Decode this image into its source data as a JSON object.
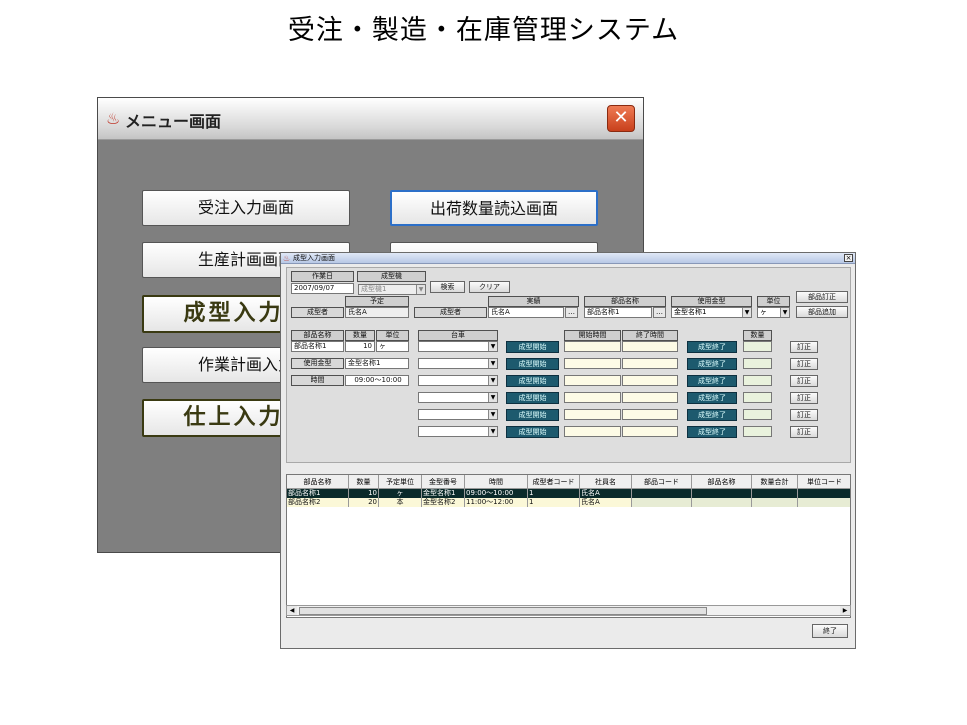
{
  "slide": {
    "title": "受注・製造・在庫管理システム"
  },
  "menu": {
    "title": "メニュー画面",
    "close_glyph": "✕",
    "buttons": [
      "受注入力画面",
      "出荷数量読込画面",
      "生産計画画面",
      "",
      "成型入力画",
      "作業計画入力",
      "仕上入力画"
    ]
  },
  "molding": {
    "title": "成型入力画面",
    "work_date_label": "作業日",
    "work_date_value": "2007/09/07",
    "machine_label": "成型機",
    "machine_value": "成型機1",
    "search_label": "検索",
    "clear_label": "クリア",
    "plan_label": "予定",
    "molder_label": "成型者",
    "plan_molder_value": "氏名A",
    "actual_label": "実績",
    "actual_molder_label": "成型者",
    "actual_molder_value": "氏名A",
    "part_name_label": "部品名称",
    "part_name_value": "部品名称1",
    "mold_label": "使用金型",
    "mold_value": "金型名称1",
    "unit_label": "単位",
    "unit_value": "ヶ",
    "part_fix_label": "部品訂正",
    "part_add_label": "部品追加",
    "plan_part_label": "部品名称",
    "qty_label": "数量",
    "plan_unit_label": "単位",
    "plan_part_value": "部品名称1",
    "plan_qty_value": "10",
    "plan_unit_value": "ヶ",
    "use_mold_label": "使用金型",
    "use_mold_value": "金型名称1",
    "time_label": "時間",
    "time_value": "09:00〜10:00",
    "vehicle_label": "台車",
    "start_time_label": "開始時間",
    "end_time_label": "終了時間",
    "count_label": "数量",
    "start_btn": "成型開始",
    "end_btn": "成型終了",
    "fix_btn": "訂正",
    "rows": 6,
    "columns": [
      "部品名称",
      "数量",
      "予定単位",
      "金型番号",
      "時間",
      "成型者コード",
      "社員名",
      "部品コード",
      "部品名称",
      "数量合計",
      "単位コード"
    ],
    "table_rows": [
      [
        "部品名称1",
        "10",
        "ヶ",
        "金型名称1",
        "09:00〜10:00",
        "1",
        "氏名A",
        "",
        "",
        "",
        ""
      ],
      [
        "部品名称2",
        "20",
        "本",
        "金型名称2",
        "11:00〜12:00",
        "1",
        "氏名A",
        "",
        "",
        "",
        ""
      ]
    ],
    "exit_label": "終了"
  }
}
